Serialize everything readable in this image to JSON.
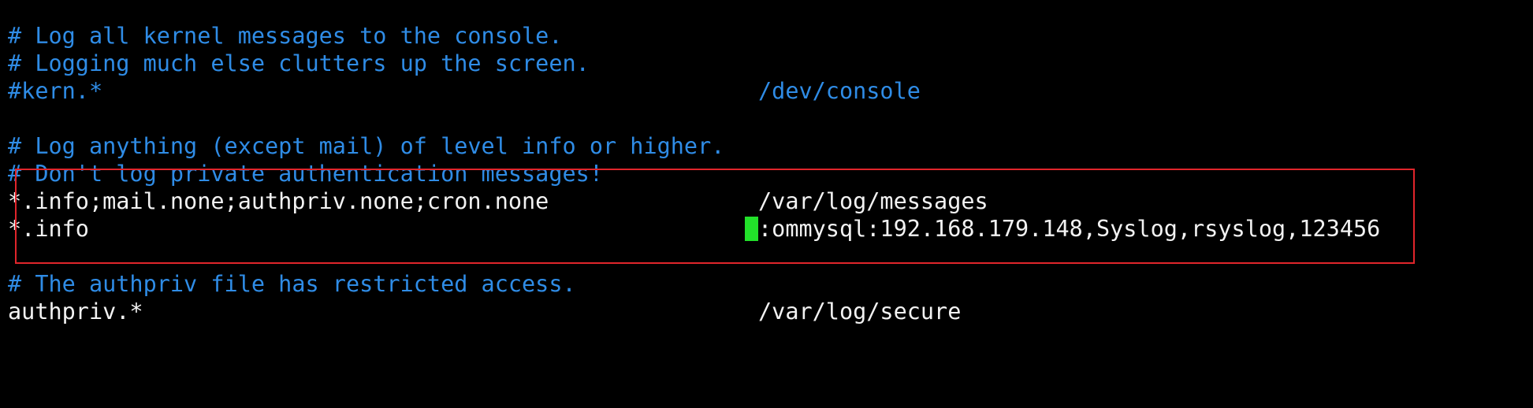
{
  "terminal": {
    "lines": [
      {
        "type": "comment",
        "left": "# Log all kernel messages to the console."
      },
      {
        "type": "comment",
        "left": "# Logging much else clutters up the screen."
      },
      {
        "type": "comment",
        "left": "#kern.*",
        "right": "/dev/console"
      },
      {
        "type": "blank"
      },
      {
        "type": "comment",
        "left": "# Log anything (except mail) of level info or higher."
      },
      {
        "type": "comment",
        "left": "# Don't log private authentication messages!"
      },
      {
        "type": "plain",
        "left": "*.info;mail.none;authpriv.none;cron.none",
        "right": "/var/log/messages"
      },
      {
        "type": "plain",
        "left": "*.info",
        "right": ":ommysql:192.168.179.148,Syslog,rsyslog,123456",
        "cursor": true
      },
      {
        "type": "blank"
      },
      {
        "type": "comment",
        "left": "# The authpriv file has restricted access."
      },
      {
        "type": "plain",
        "left": "authpriv.*",
        "right": "/var/log/secure"
      }
    ]
  },
  "colors": {
    "background": "#000000",
    "comment": "#2f8ce6",
    "text": "#f2f2f2",
    "cursor": "#22e02a",
    "highlight_border": "#e0252b"
  }
}
